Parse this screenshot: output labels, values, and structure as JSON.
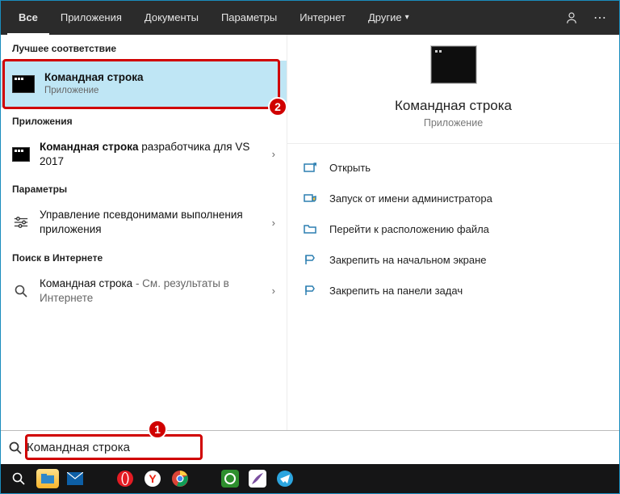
{
  "tabs": {
    "items": [
      {
        "label": "Все",
        "active": true
      },
      {
        "label": "Приложения"
      },
      {
        "label": "Документы"
      },
      {
        "label": "Параметры"
      },
      {
        "label": "Интернет"
      },
      {
        "label": "Другие",
        "dropdown": true
      }
    ]
  },
  "left": {
    "best_match_header": "Лучшее соответствие",
    "best_match": {
      "title": "Командная строка",
      "sub": "Приложение"
    },
    "apps_header": "Приложения",
    "apps": [
      {
        "title_bold": "Командная строка",
        "title_rest": " разработчика для VS 2017"
      }
    ],
    "settings_header": "Параметры",
    "settings": [
      {
        "title": "Управление псевдонимами выполнения приложения"
      }
    ],
    "web_header": "Поиск в Интернете",
    "web": [
      {
        "title": "Командная строка",
        "sub": " - См. результаты в Интернете"
      }
    ]
  },
  "preview": {
    "title": "Командная строка",
    "sub": "Приложение"
  },
  "actions": [
    {
      "label": "Открыть",
      "icon": "open"
    },
    {
      "label": "Запуск от имени администратора",
      "icon": "admin"
    },
    {
      "label": "Перейти к расположению файла",
      "icon": "folder"
    },
    {
      "label": "Закрепить на начальном экране",
      "icon": "pin-start"
    },
    {
      "label": "Закрепить на панели задач",
      "icon": "pin-task"
    }
  ],
  "search": {
    "value": "Командная строка"
  },
  "annotations": {
    "search_badge": "1",
    "result_badge": "2"
  }
}
